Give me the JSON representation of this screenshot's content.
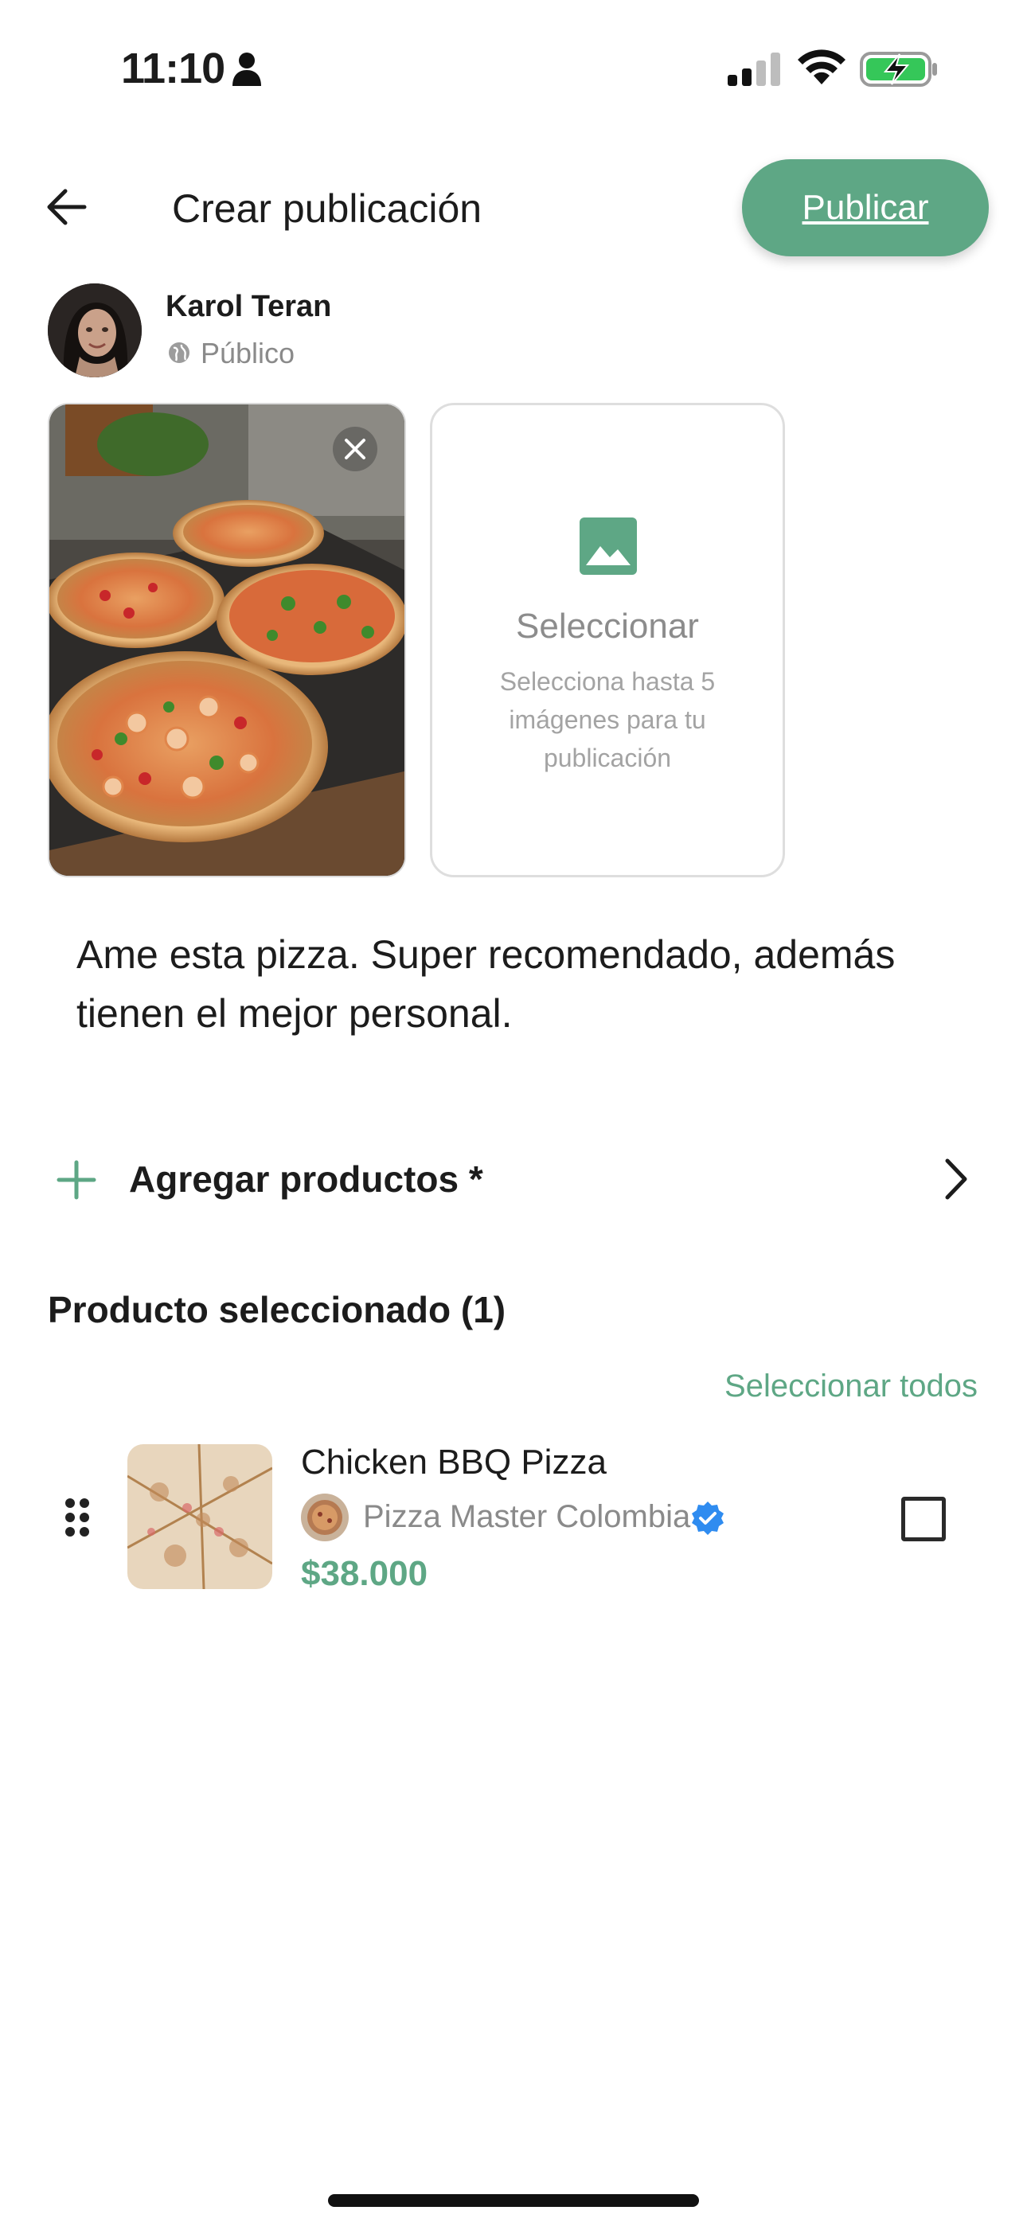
{
  "status_bar": {
    "time": "11:10",
    "icons": [
      "person-icon",
      "signal-icon",
      "wifi-icon",
      "battery-charging-icon"
    ]
  },
  "header": {
    "title": "Crear publicación",
    "publish_label": "Publicar",
    "back_icon": "arrow-left-icon"
  },
  "user": {
    "name": "Karol Teran",
    "audience": "Público",
    "audience_icon": "globe-icon"
  },
  "media": {
    "remove_icon": "close-icon",
    "select_icon": "image-icon",
    "select_title": "Seleccionar",
    "select_hint": "Selecciona hasta 5 imágenes para tu publicación"
  },
  "caption": "Ame esta pizza. Super recomendado, además tienen el mejor personal.",
  "products": {
    "add_label": "Agregar productos *",
    "add_icon": "plus-icon",
    "chevron_icon": "chevron-right-icon",
    "selected_title": "Producto seleccionado (1)",
    "select_all_label": "Seleccionar todos",
    "items": [
      {
        "name": "Chicken BBQ Pizza",
        "store": "Pizza Master Colombia",
        "verified": true,
        "price": "$38.000",
        "checked": false
      }
    ]
  },
  "colors": {
    "accent": "#5ea785",
    "verified": "#2f8cf0",
    "text_primary": "#1c1c1c",
    "text_secondary": "#8a8a8a"
  }
}
